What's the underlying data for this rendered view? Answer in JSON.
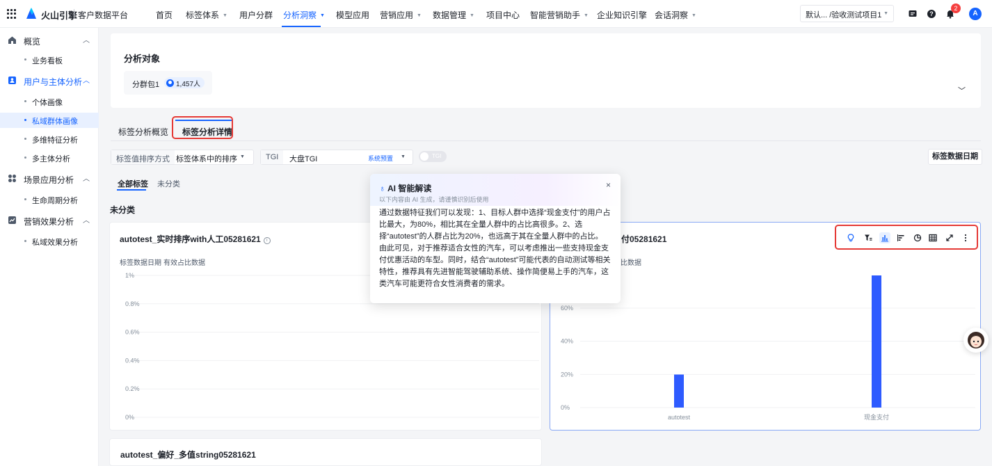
{
  "brand": {
    "name": "火山引擎",
    "product": "客户数据平台"
  },
  "nav": [
    {
      "label": "首页",
      "caret": false,
      "active": false
    },
    {
      "label": "标签体系",
      "caret": true,
      "active": false
    },
    {
      "label": "用户分群",
      "caret": false,
      "active": false
    },
    {
      "label": "分析洞察",
      "caret": true,
      "active": true
    },
    {
      "label": "模型应用",
      "caret": false,
      "active": false
    },
    {
      "label": "营销应用",
      "caret": true,
      "active": false
    },
    {
      "label": "数据管理",
      "caret": true,
      "active": false
    },
    {
      "label": "项目中心",
      "caret": false,
      "active": false
    },
    {
      "label": "智能营销助手",
      "caret": true,
      "active": false
    },
    {
      "label": "企业知识引擎",
      "caret": false,
      "active": false
    },
    {
      "label": "会话洞察",
      "caret": true,
      "active": false
    }
  ],
  "project_select": {
    "value": "默认... /验收测试项目1"
  },
  "notifications": {
    "count": "2"
  },
  "user": {
    "initial": "A"
  },
  "sidebar": {
    "groups": [
      {
        "label": "概览",
        "items": [
          {
            "label": "业务看板",
            "active": false
          }
        ]
      },
      {
        "label": "用户与主体分析",
        "active": true,
        "items": [
          {
            "label": "个体画像",
            "active": false
          },
          {
            "label": "私域群体画像",
            "active": true
          },
          {
            "label": "多维特征分析",
            "active": false
          },
          {
            "label": "多主体分析",
            "active": false
          }
        ]
      },
      {
        "label": "场景应用分析",
        "items": [
          {
            "label": "生命周期分析",
            "active": false
          }
        ]
      },
      {
        "label": "营销效果分析",
        "items": [
          {
            "label": "私域效果分析",
            "active": false
          }
        ]
      }
    ]
  },
  "analysis_object": {
    "title": "分析对象",
    "package_name": "分群包1",
    "package_count": "1,457人"
  },
  "tabs": [
    {
      "label": "标签分析概览",
      "active": false
    },
    {
      "label": "标签分析详情",
      "active": true
    }
  ],
  "filters": {
    "sort_label": "标签值排序方式",
    "sort_value": "标签体系中的排序",
    "tgi_label": "TGI",
    "tgi_value": "大盘TGI",
    "tgi_tag": "系统预置",
    "toggle_label": "TGI",
    "date_button": "标签数据日期"
  },
  "subtabs": [
    {
      "label": "全部标签",
      "active": true
    },
    {
      "label": "未分类",
      "active": false
    }
  ],
  "section_title": "未分类",
  "chart_left": {
    "title": "autotest_实时排序with人工05281621",
    "info_icon": "ⓘ",
    "meta": [
      "标签数据日期",
      "有效占比数据"
    ]
  },
  "chart_right": {
    "title_suffix": "付05281621",
    "meta_suffix": "占比数据"
  },
  "ai_popup": {
    "title": "AI 智能解读",
    "note": "以下内容由 AI 生成，请谨慎识别后使用",
    "paragraph1": "通过数据特征我们可以发现：1、目标人群中选择“现金支付”的用户占比最大，为80%，相比其在全量人群中的占比高很多。2、选择“autotest”的人群占比为20%，也远高于其在全量人群中的占比。",
    "paragraph2": "由此可见，对于推荐适合女性的汽车，可以考虑推出一些支持现金支付优惠活动的车型。同时，结合“autotest”可能代表的自动测试等相关特性，推荐具有先进智能驾驶辅助系统、操作简便易上手的汽车，这类汽车可能更符合女性消费者的需求。",
    "close_icon": "×"
  },
  "toolbar_icons": [
    "bulb-icon",
    "filter-sort-icon",
    "bar-chart-icon",
    "bar-horizontal-icon",
    "pie-chart-icon",
    "table-icon",
    "expand-icon",
    "more-icon"
  ],
  "bottom_card": {
    "title": "autotest_偏好_多值string05281621"
  },
  "colors": {
    "accent": "#1664ff",
    "highlight": "#e53935",
    "bar": "#2e5bff"
  },
  "chart_data": [
    {
      "type": "bar",
      "categories": [],
      "values": [],
      "ylim": [
        0,
        1
      ],
      "yticks": [
        "1%",
        "0.8%",
        "0.6%",
        "0.4%",
        "0.2%",
        "0%"
      ]
    },
    {
      "type": "bar",
      "categories": [
        "autotest",
        "现金支付"
      ],
      "values": [
        20,
        80
      ],
      "ylim": [
        0,
        80
      ],
      "yticks": [
        "60%",
        "40%",
        "20%",
        "0%"
      ]
    }
  ]
}
